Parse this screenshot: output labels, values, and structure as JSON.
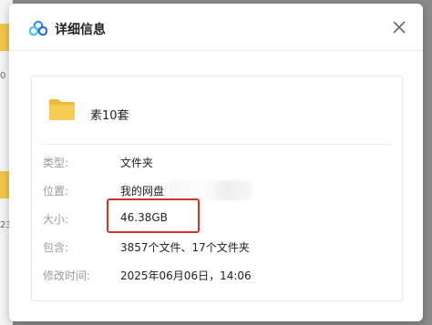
{
  "background": {
    "label_top": "0",
    "label_bottom": "23"
  },
  "dialog": {
    "title": "详细信息",
    "close_icon": "close-icon",
    "logo_icon": "cloud-logo-icon"
  },
  "file": {
    "name": "素10套",
    "icon": "folder-icon"
  },
  "details": [
    {
      "label": "类型:",
      "value": "文件夹"
    },
    {
      "label": "位置:",
      "value": "我的网盘"
    },
    {
      "label": "大小:",
      "value": "46.38GB"
    },
    {
      "label": "包含:",
      "value": "3857个文件、17个文件夹"
    },
    {
      "label": "修改时间:",
      "value": "2025年06月06日，14:06"
    }
  ],
  "colors": {
    "highlight": "#d9302c",
    "folder": "#f2c64a"
  }
}
